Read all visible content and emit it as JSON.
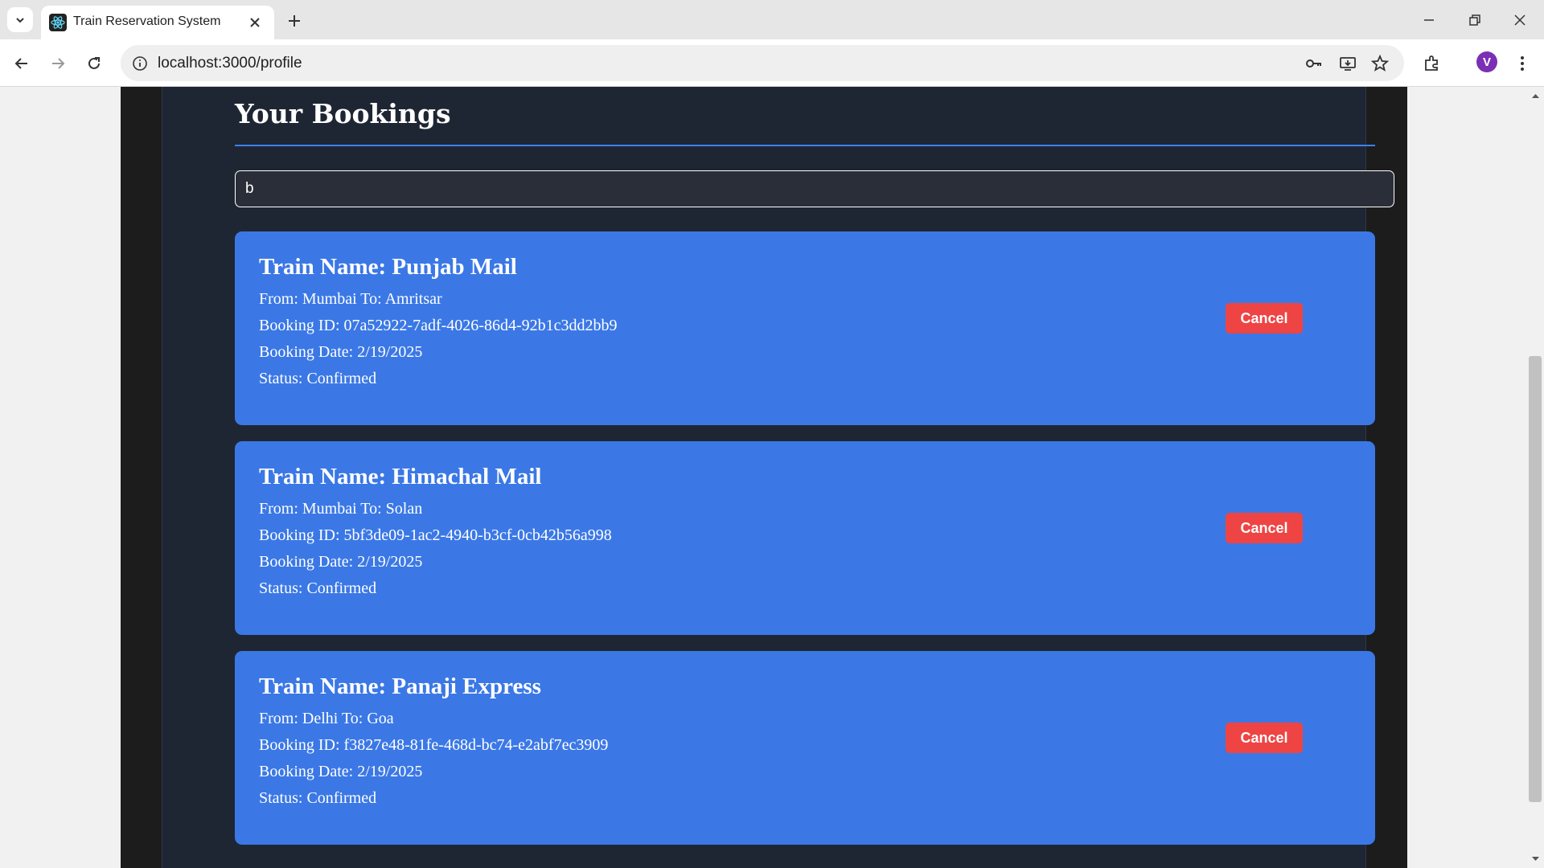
{
  "browser": {
    "tab_title": "Train Reservation System",
    "url": "localhost:3000/profile",
    "profile_initial": "V",
    "icons": [
      "tab-search-icon",
      "react-favicon-icon",
      "close-icon",
      "plus-icon",
      "minimize-icon",
      "restore-icon",
      "close-window-icon",
      "back-arrow-icon",
      "forward-arrow-icon",
      "reload-icon",
      "info-icon",
      "key-icon",
      "install-icon",
      "star-icon",
      "extensions-icon",
      "more-vert-icon"
    ]
  },
  "page": {
    "title": "Your Bookings",
    "search_value": "b",
    "colors": {
      "card": "#3b78e6",
      "cancel": "#ef4444",
      "panel": "#1f2633",
      "accent": "#3b82f6"
    }
  },
  "bookings": [
    {
      "train_name": "Train Name: Punjab Mail",
      "route": "From: Mumbai To: Amritsar",
      "booking_id": "Booking ID: 07a52922-7adf-4026-86d4-92b1c3dd2bb9",
      "booking_date": "Booking Date: 2/19/2025",
      "status": "Status: Confirmed",
      "cancel_label": "Cancel"
    },
    {
      "train_name": "Train Name: Himachal Mail",
      "route": "From: Mumbai To: Solan",
      "booking_id": "Booking ID: 5bf3de09-1ac2-4940-b3cf-0cb42b56a998",
      "booking_date": "Booking Date: 2/19/2025",
      "status": "Status: Confirmed",
      "cancel_label": "Cancel"
    },
    {
      "train_name": "Train Name: Panaji Express",
      "route": "From: Delhi To: Goa",
      "booking_id": "Booking ID: f3827e48-81fe-468d-bc74-e2abf7ec3909",
      "booking_date": "Booking Date: 2/19/2025",
      "status": "Status: Confirmed",
      "cancel_label": "Cancel"
    }
  ]
}
